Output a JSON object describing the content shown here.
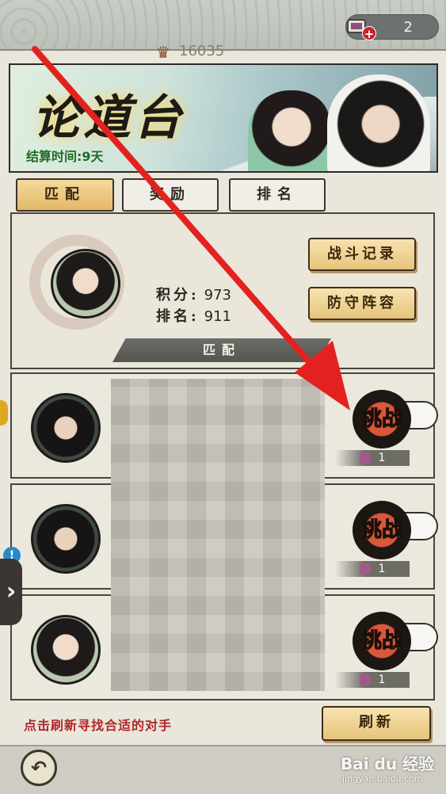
{
  "topbar": {
    "currency_count": "2",
    "currency_plus": "+"
  },
  "banner": {
    "title": "论道台",
    "settle_time": "结算时间:9天"
  },
  "tabs": [
    {
      "label": "匹配"
    },
    {
      "label": "奖励"
    },
    {
      "label": "排名"
    }
  ],
  "player": {
    "power": "16035",
    "score_label": "积分:",
    "score": "973",
    "rank_label": "排名:",
    "rank": "911"
  },
  "buttons": {
    "battle_record": "战斗记录",
    "defense_lineup": "防守阵容",
    "match_bar": "匹配",
    "refresh": "刷新"
  },
  "opponents": [
    {
      "challenge_label": "挑战",
      "cost": "1"
    },
    {
      "challenge_label": "挑战",
      "cost": "1"
    },
    {
      "challenge_label": "挑战",
      "cost": "1"
    }
  ],
  "hint": "点击刷新寻找合适的对手",
  "watermark": {
    "main": "Bai du 经验",
    "sub": "jingyan.baidu.com"
  },
  "colors": {
    "accent_gold": "#e7c47c",
    "hint_red": "#b1262a",
    "arrow_red": "#e3221f"
  }
}
